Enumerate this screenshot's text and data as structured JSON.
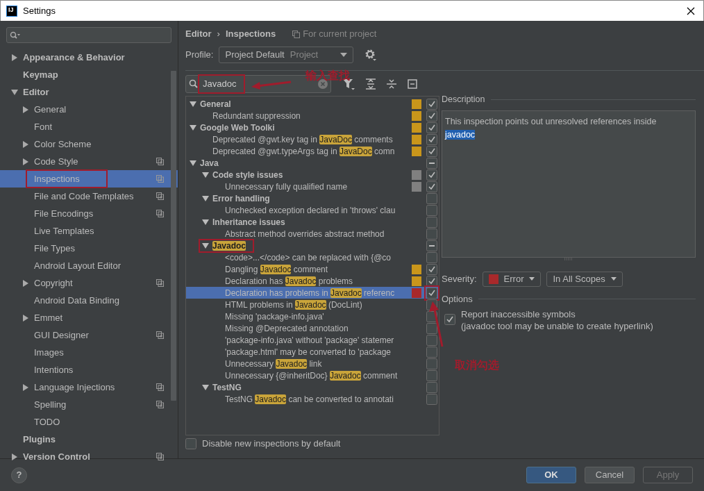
{
  "window": {
    "icon_text": "IJ",
    "title": "Settings"
  },
  "sidebar": {
    "items": [
      {
        "label": "Appearance & Behavior",
        "kind": "folder",
        "expanded": false,
        "selected": false
      },
      {
        "label": "Keymap",
        "kind": "leaf",
        "selected": false
      },
      {
        "label": "Editor",
        "kind": "folder",
        "expanded": true,
        "selected": false,
        "children": [
          {
            "label": "General",
            "kind": "folder",
            "expanded": false,
            "selected": false
          },
          {
            "label": "Font",
            "kind": "leaf",
            "selected": false
          },
          {
            "label": "Color Scheme",
            "kind": "folder",
            "expanded": false,
            "selected": false
          },
          {
            "label": "Code Style",
            "kind": "folder",
            "expanded": false,
            "selected": false,
            "project_scope": true
          },
          {
            "label": "Inspections",
            "kind": "leaf",
            "selected": true,
            "project_scope": true,
            "annotated": true
          },
          {
            "label": "File and Code Templates",
            "kind": "leaf",
            "selected": false,
            "project_scope": true
          },
          {
            "label": "File Encodings",
            "kind": "leaf",
            "selected": false,
            "project_scope": true
          },
          {
            "label": "Live Templates",
            "kind": "leaf",
            "selected": false
          },
          {
            "label": "File Types",
            "kind": "leaf",
            "selected": false
          },
          {
            "label": "Android Layout Editor",
            "kind": "leaf",
            "selected": false
          },
          {
            "label": "Copyright",
            "kind": "folder",
            "expanded": false,
            "selected": false,
            "project_scope": true
          },
          {
            "label": "Android Data Binding",
            "kind": "leaf",
            "selected": false
          },
          {
            "label": "Emmet",
            "kind": "folder",
            "expanded": false,
            "selected": false
          },
          {
            "label": "GUI Designer",
            "kind": "leaf",
            "selected": false,
            "project_scope": true
          },
          {
            "label": "Images",
            "kind": "leaf",
            "selected": false
          },
          {
            "label": "Intentions",
            "kind": "leaf",
            "selected": false
          },
          {
            "label": "Language Injections",
            "kind": "folder",
            "expanded": false,
            "selected": false,
            "project_scope": true
          },
          {
            "label": "Spelling",
            "kind": "leaf",
            "selected": false,
            "project_scope": true
          },
          {
            "label": "TODO",
            "kind": "leaf",
            "selected": false
          }
        ]
      },
      {
        "label": "Plugins",
        "kind": "leaf",
        "selected": false
      },
      {
        "label": "Version Control",
        "kind": "folder",
        "expanded": false,
        "selected": false,
        "project_scope": true
      }
    ]
  },
  "breadcrumb": {
    "parent": "Editor",
    "separator": "›",
    "current": "Inspections",
    "scope": "For current project"
  },
  "profile": {
    "label": "Profile:",
    "value": "Project Default",
    "scope": "Project"
  },
  "filter": {
    "value": "Javadoc",
    "annotated": true
  },
  "tree": [
    {
      "parts": [
        {
          "text": "General",
          "match": false
        }
      ],
      "kind": "group",
      "expanded": true,
      "checked": true,
      "partial": false,
      "color": "#c9961b",
      "selected": false,
      "children": [
        {
          "parts": [
            {
              "text": "Redundant suppression",
              "match": false
            }
          ],
          "kind": "item",
          "checked": true,
          "partial": false,
          "color": "#c9961b",
          "selected": false
        }
      ]
    },
    {
      "parts": [
        {
          "text": "Google Web Toolki",
          "match": false
        }
      ],
      "kind": "group",
      "expanded": true,
      "checked": true,
      "partial": false,
      "color": "#c9961b",
      "selected": false,
      "children": [
        {
          "parts": [
            {
              "text": "Deprecated @gwt.key tag in ",
              "match": false
            },
            {
              "text": "JavaDoc",
              "match": true
            },
            {
              "text": " comments",
              "match": false
            }
          ],
          "kind": "item",
          "checked": true,
          "partial": false,
          "color": "#c9961b",
          "selected": false
        },
        {
          "parts": [
            {
              "text": "Deprecated @gwt.typeArgs tag in ",
              "match": false
            },
            {
              "text": "JavaDoc",
              "match": true
            },
            {
              "text": " comn",
              "match": false
            }
          ],
          "kind": "item",
          "checked": true,
          "partial": false,
          "color": "#c9961b",
          "selected": false
        }
      ]
    },
    {
      "parts": [
        {
          "text": "Java",
          "match": false
        }
      ],
      "kind": "group",
      "expanded": true,
      "checked": false,
      "partial": true,
      "selected": false,
      "children": [
        {
          "parts": [
            {
              "text": "Code style issues",
              "match": false
            }
          ],
          "kind": "group",
          "expanded": true,
          "checked": true,
          "partial": false,
          "color": "#808080",
          "selected": false,
          "children": [
            {
              "parts": [
                {
                  "text": "Unnecessary fully qualified name",
                  "match": false
                }
              ],
              "kind": "item",
              "checked": true,
              "partial": false,
              "color": "#808080",
              "selected": false
            }
          ]
        },
        {
          "parts": [
            {
              "text": "Error handling",
              "match": false
            }
          ],
          "kind": "group",
          "expanded": true,
          "checked": false,
          "partial": false,
          "selected": false,
          "children": [
            {
              "parts": [
                {
                  "text": "Unchecked exception declared in 'throws' clau",
                  "match": false
                }
              ],
              "kind": "item",
              "checked": false,
              "partial": false,
              "selected": false
            }
          ]
        },
        {
          "parts": [
            {
              "text": "Inheritance issues",
              "match": false
            }
          ],
          "kind": "group",
          "expanded": true,
          "checked": false,
          "partial": false,
          "selected": false,
          "children": [
            {
              "parts": [
                {
                  "text": "Abstract method overrides abstract method",
                  "match": false
                }
              ],
              "kind": "item",
              "checked": false,
              "partial": false,
              "selected": false
            }
          ]
        },
        {
          "parts": [
            {
              "text": "Javadoc",
              "match": true
            }
          ],
          "kind": "group",
          "expanded": true,
          "checked": false,
          "partial": true,
          "selected": false,
          "annotated": true,
          "children": [
            {
              "parts": [
                {
                  "text": "<code>...</code> can be replaced with {@co",
                  "match": false
                }
              ],
              "kind": "item",
              "checked": false,
              "partial": false,
              "selected": false
            },
            {
              "parts": [
                {
                  "text": "Dangling ",
                  "match": false
                },
                {
                  "text": "Javadoc",
                  "match": true
                },
                {
                  "text": " comment",
                  "match": false
                }
              ],
              "kind": "item",
              "checked": true,
              "partial": false,
              "color": "#c9961b",
              "selected": false
            },
            {
              "parts": [
                {
                  "text": "Declaration has ",
                  "match": false
                },
                {
                  "text": "Javadoc",
                  "match": true
                },
                {
                  "text": " problems",
                  "match": false
                }
              ],
              "kind": "item",
              "checked": true,
              "partial": false,
              "color": "#c9961b",
              "selected": false
            },
            {
              "parts": [
                {
                  "text": "Declaration has problems in ",
                  "match": false
                },
                {
                  "text": "Javadoc",
                  "match": true
                },
                {
                  "text": " referenc",
                  "match": false
                }
              ],
              "kind": "item",
              "checked": true,
              "partial": false,
              "color": "#a8292b",
              "selected": true,
              "check_annotated": true
            },
            {
              "parts": [
                {
                  "text": "HTML problems in ",
                  "match": false
                },
                {
                  "text": "Javadoc",
                  "match": true
                },
                {
                  "text": " (DocLint)",
                  "match": false
                }
              ],
              "kind": "item",
              "checked": false,
              "partial": false,
              "selected": false
            },
            {
              "parts": [
                {
                  "text": "Missing 'package-info.java'",
                  "match": false
                }
              ],
              "kind": "item",
              "checked": false,
              "partial": false,
              "selected": false
            },
            {
              "parts": [
                {
                  "text": "Missing @Deprecated annotation",
                  "match": false
                }
              ],
              "kind": "item",
              "checked": false,
              "partial": false,
              "selected": false
            },
            {
              "parts": [
                {
                  "text": "'package-info.java' without 'package' statemer",
                  "match": false
                }
              ],
              "kind": "item",
              "checked": false,
              "partial": false,
              "selected": false
            },
            {
              "parts": [
                {
                  "text": "'package.html' may be converted to 'package",
                  "match": false
                }
              ],
              "kind": "item",
              "checked": false,
              "partial": false,
              "selected": false
            },
            {
              "parts": [
                {
                  "text": "Unnecessary ",
                  "match": false
                },
                {
                  "text": "Javadoc",
                  "match": true
                },
                {
                  "text": " link",
                  "match": false
                }
              ],
              "kind": "item",
              "checked": false,
              "partial": false,
              "selected": false
            },
            {
              "parts": [
                {
                  "text": "Unnecessary {@inheritDoc} ",
                  "match": false
                },
                {
                  "text": "Javadoc",
                  "match": true
                },
                {
                  "text": " comment",
                  "match": false
                }
              ],
              "kind": "item",
              "checked": false,
              "partial": false,
              "selected": false
            }
          ]
        },
        {
          "parts": [
            {
              "text": "TestNG",
              "match": false
            }
          ],
          "kind": "group",
          "expanded": true,
          "checked": false,
          "partial": false,
          "selected": false,
          "children": [
            {
              "parts": [
                {
                  "text": "TestNG ",
                  "match": false
                },
                {
                  "text": "Javadoc",
                  "match": true
                },
                {
                  "text": " can be converted to annotati",
                  "match": false
                }
              ],
              "kind": "item",
              "checked": false,
              "partial": false,
              "selected": false
            }
          ]
        }
      ]
    }
  ],
  "disable_new": {
    "label": "Disable new inspections by default",
    "checked": false
  },
  "description": {
    "heading": "Description",
    "parts": [
      {
        "text": "This inspection points out unresolved references inside ",
        "highlighted": false
      },
      {
        "text": "javadoc",
        "highlighted": true
      }
    ]
  },
  "severity": {
    "label": "Severity:",
    "value": "Error",
    "color": "#a8292b",
    "scope": "In All Scopes"
  },
  "options": {
    "heading": "Options",
    "items": [
      {
        "label": "Report inaccessible symbols\n(javadoc tool may be unable to create hyperlink)",
        "checked": true
      }
    ]
  },
  "buttons": [
    {
      "label": "OK",
      "kind": "primary",
      "disabled": false
    },
    {
      "label": "Cancel",
      "kind": "default",
      "disabled": false
    },
    {
      "label": "Apply",
      "kind": "default",
      "disabled": true
    }
  ],
  "help": "?",
  "annotations": [
    {
      "kind": "search",
      "text": "输入查找"
    },
    {
      "kind": "checkbox",
      "text": "取消勾选"
    }
  ]
}
